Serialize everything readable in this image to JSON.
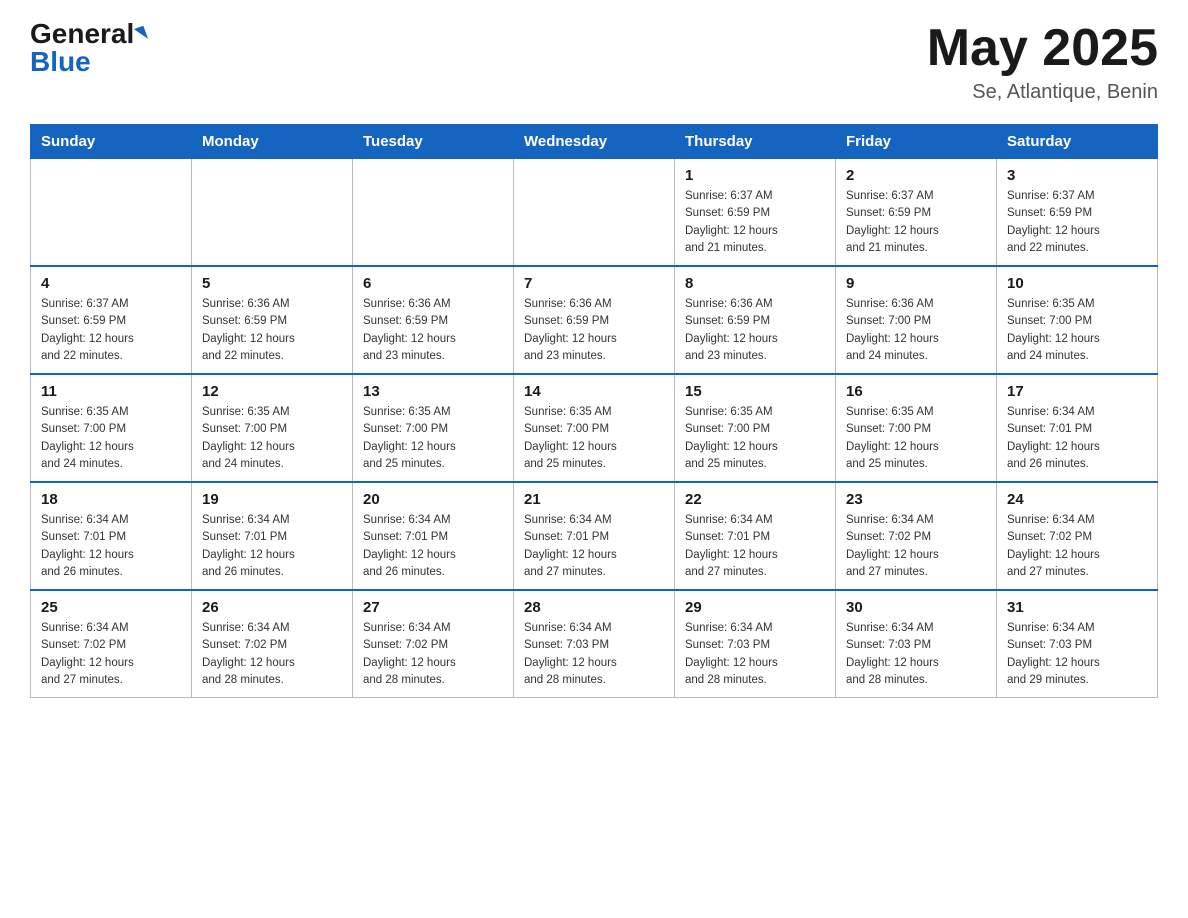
{
  "header": {
    "logo_general": "General",
    "logo_blue": "Blue",
    "title": "May 2025",
    "location": "Se, Atlantique, Benin"
  },
  "days_of_week": [
    "Sunday",
    "Monday",
    "Tuesday",
    "Wednesday",
    "Thursday",
    "Friday",
    "Saturday"
  ],
  "weeks": [
    [
      {
        "day": "",
        "info": ""
      },
      {
        "day": "",
        "info": ""
      },
      {
        "day": "",
        "info": ""
      },
      {
        "day": "",
        "info": ""
      },
      {
        "day": "1",
        "info": "Sunrise: 6:37 AM\nSunset: 6:59 PM\nDaylight: 12 hours\nand 21 minutes."
      },
      {
        "day": "2",
        "info": "Sunrise: 6:37 AM\nSunset: 6:59 PM\nDaylight: 12 hours\nand 21 minutes."
      },
      {
        "day": "3",
        "info": "Sunrise: 6:37 AM\nSunset: 6:59 PM\nDaylight: 12 hours\nand 22 minutes."
      }
    ],
    [
      {
        "day": "4",
        "info": "Sunrise: 6:37 AM\nSunset: 6:59 PM\nDaylight: 12 hours\nand 22 minutes."
      },
      {
        "day": "5",
        "info": "Sunrise: 6:36 AM\nSunset: 6:59 PM\nDaylight: 12 hours\nand 22 minutes."
      },
      {
        "day": "6",
        "info": "Sunrise: 6:36 AM\nSunset: 6:59 PM\nDaylight: 12 hours\nand 23 minutes."
      },
      {
        "day": "7",
        "info": "Sunrise: 6:36 AM\nSunset: 6:59 PM\nDaylight: 12 hours\nand 23 minutes."
      },
      {
        "day": "8",
        "info": "Sunrise: 6:36 AM\nSunset: 6:59 PM\nDaylight: 12 hours\nand 23 minutes."
      },
      {
        "day": "9",
        "info": "Sunrise: 6:36 AM\nSunset: 7:00 PM\nDaylight: 12 hours\nand 24 minutes."
      },
      {
        "day": "10",
        "info": "Sunrise: 6:35 AM\nSunset: 7:00 PM\nDaylight: 12 hours\nand 24 minutes."
      }
    ],
    [
      {
        "day": "11",
        "info": "Sunrise: 6:35 AM\nSunset: 7:00 PM\nDaylight: 12 hours\nand 24 minutes."
      },
      {
        "day": "12",
        "info": "Sunrise: 6:35 AM\nSunset: 7:00 PM\nDaylight: 12 hours\nand 24 minutes."
      },
      {
        "day": "13",
        "info": "Sunrise: 6:35 AM\nSunset: 7:00 PM\nDaylight: 12 hours\nand 25 minutes."
      },
      {
        "day": "14",
        "info": "Sunrise: 6:35 AM\nSunset: 7:00 PM\nDaylight: 12 hours\nand 25 minutes."
      },
      {
        "day": "15",
        "info": "Sunrise: 6:35 AM\nSunset: 7:00 PM\nDaylight: 12 hours\nand 25 minutes."
      },
      {
        "day": "16",
        "info": "Sunrise: 6:35 AM\nSunset: 7:00 PM\nDaylight: 12 hours\nand 25 minutes."
      },
      {
        "day": "17",
        "info": "Sunrise: 6:34 AM\nSunset: 7:01 PM\nDaylight: 12 hours\nand 26 minutes."
      }
    ],
    [
      {
        "day": "18",
        "info": "Sunrise: 6:34 AM\nSunset: 7:01 PM\nDaylight: 12 hours\nand 26 minutes."
      },
      {
        "day": "19",
        "info": "Sunrise: 6:34 AM\nSunset: 7:01 PM\nDaylight: 12 hours\nand 26 minutes."
      },
      {
        "day": "20",
        "info": "Sunrise: 6:34 AM\nSunset: 7:01 PM\nDaylight: 12 hours\nand 26 minutes."
      },
      {
        "day": "21",
        "info": "Sunrise: 6:34 AM\nSunset: 7:01 PM\nDaylight: 12 hours\nand 27 minutes."
      },
      {
        "day": "22",
        "info": "Sunrise: 6:34 AM\nSunset: 7:01 PM\nDaylight: 12 hours\nand 27 minutes."
      },
      {
        "day": "23",
        "info": "Sunrise: 6:34 AM\nSunset: 7:02 PM\nDaylight: 12 hours\nand 27 minutes."
      },
      {
        "day": "24",
        "info": "Sunrise: 6:34 AM\nSunset: 7:02 PM\nDaylight: 12 hours\nand 27 minutes."
      }
    ],
    [
      {
        "day": "25",
        "info": "Sunrise: 6:34 AM\nSunset: 7:02 PM\nDaylight: 12 hours\nand 27 minutes."
      },
      {
        "day": "26",
        "info": "Sunrise: 6:34 AM\nSunset: 7:02 PM\nDaylight: 12 hours\nand 28 minutes."
      },
      {
        "day": "27",
        "info": "Sunrise: 6:34 AM\nSunset: 7:02 PM\nDaylight: 12 hours\nand 28 minutes."
      },
      {
        "day": "28",
        "info": "Sunrise: 6:34 AM\nSunset: 7:03 PM\nDaylight: 12 hours\nand 28 minutes."
      },
      {
        "day": "29",
        "info": "Sunrise: 6:34 AM\nSunset: 7:03 PM\nDaylight: 12 hours\nand 28 minutes."
      },
      {
        "day": "30",
        "info": "Sunrise: 6:34 AM\nSunset: 7:03 PM\nDaylight: 12 hours\nand 28 minutes."
      },
      {
        "day": "31",
        "info": "Sunrise: 6:34 AM\nSunset: 7:03 PM\nDaylight: 12 hours\nand 29 minutes."
      }
    ]
  ]
}
